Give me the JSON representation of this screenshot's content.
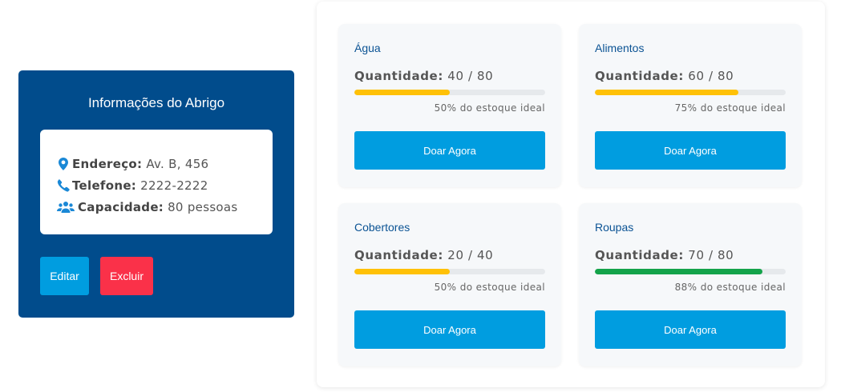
{
  "shelter": {
    "title": "Informações do Abrigo",
    "address_label": "Endereço:",
    "address_value": "Av. B, 456",
    "phone_label": "Telefone:",
    "phone_value": "2222-2222",
    "capacity_label": "Capacidade:",
    "capacity_value": "80 pessoas",
    "edit_label": "Editar",
    "delete_label": "Excluir"
  },
  "colors": {
    "shelter_bg": "#014c8c",
    "primary": "#009de0",
    "danger": "#fa3149",
    "progress_warning": "#ffc107",
    "progress_success": "#14a34a"
  },
  "items": [
    {
      "name": "Água",
      "qty_label": "Quantidade:",
      "qty_value": "40 / 80",
      "progress": 0.5,
      "status": "warning",
      "pct_text": "50% do estoque ideal",
      "button": "Doar Agora"
    },
    {
      "name": "Alimentos",
      "qty_label": "Quantidade:",
      "qty_value": "60 / 80",
      "progress": 0.75,
      "status": "warning",
      "pct_text": "75% do estoque ideal",
      "button": "Doar Agora"
    },
    {
      "name": "Cobertores",
      "qty_label": "Quantidade:",
      "qty_value": "20 / 40",
      "progress": 0.5,
      "status": "warning",
      "pct_text": "50% do estoque ideal",
      "button": "Doar Agora"
    },
    {
      "name": "Roupas",
      "qty_label": "Quantidade:",
      "qty_value": "70 / 80",
      "progress": 0.88,
      "status": "success",
      "pct_text": "88% do estoque ideal",
      "button": "Doar Agora"
    }
  ]
}
